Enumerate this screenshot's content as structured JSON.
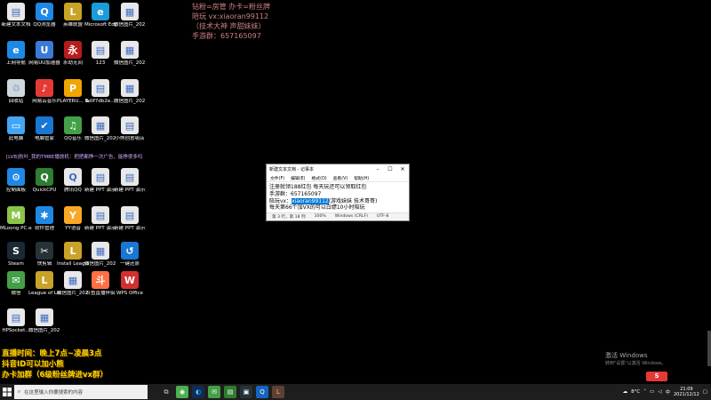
{
  "desktop_icons": [
    {
      "label": "新建文本文档",
      "color": "#e8e8e8",
      "glyph": "▤"
    },
    {
      "label": "QQ浏览器",
      "color": "#1e88e5",
      "glyph": "Q"
    },
    {
      "label": "英雄联盟",
      "color": "#c9a227",
      "glyph": "L"
    },
    {
      "label": "Microsoft Edge",
      "color": "#1b9bd7",
      "glyph": "e"
    },
    {
      "label": "微信图片_2021112...",
      "color": "#e8e8e8",
      "glyph": "▦"
    },
    {
      "label": "上网导航",
      "color": "#1e88e5",
      "glyph": "e"
    },
    {
      "label": "网易UU加速器",
      "color": "#3a7bd5",
      "glyph": "U"
    },
    {
      "label": "永劫无间",
      "color": "#b71c1c",
      "glyph": "永"
    },
    {
      "label": "123",
      "color": "#e8e8e8",
      "glyph": "▤"
    },
    {
      "label": "微信图片_2021112...",
      "color": "#e8e8e8",
      "glyph": "▦"
    },
    {
      "label": "回收站",
      "color": "#cfd8dc",
      "glyph": "♲"
    },
    {
      "label": "网易云音乐",
      "color": "#e53935",
      "glyph": "♪"
    },
    {
      "label": "PLAYERU... BATTLEGR...",
      "color": "#f0a500",
      "glyph": "P"
    },
    {
      "label": "bdlf7db2e...",
      "color": "#e8e8e8",
      "glyph": "▤"
    },
    {
      "label": "微信图片_2021112...",
      "color": "#e8e8e8",
      "glyph": "▦"
    },
    {
      "label": "此电脑",
      "color": "#42a5f5",
      "glyph": "▭"
    },
    {
      "label": "电脑管家",
      "color": "#1976d2",
      "glyph": "✔"
    },
    {
      "label": "QQ音乐",
      "color": "#43a047",
      "glyph": "♫"
    },
    {
      "label": "微信图片_2021112...",
      "color": "#e8e8e8",
      "glyph": "▦"
    },
    {
      "label": "小熊创意吸店",
      "color": "#e8e8e8",
      "glyph": "▤"
    },
    {
      "label": "控制面板",
      "color": "#1e88e5",
      "glyph": "⚙"
    },
    {
      "label": "QuickCPU",
      "color": "#2e7d32",
      "glyph": "Q"
    },
    {
      "label": "腾讯QQ",
      "color": "#e8e8e8",
      "glyph": "Q"
    },
    {
      "label": "新建 PPT 演示文稿",
      "color": "#e8e8e8",
      "glyph": "▤"
    },
    {
      "label": "新建 PPT 演示文稿",
      "color": "#e8e8e8",
      "glyph": "▤"
    },
    {
      "label": "MLoong PC.exe",
      "color": "#8bc34a",
      "glyph": "M"
    },
    {
      "label": "软件管理",
      "color": "#1e88e5",
      "glyph": "✱"
    },
    {
      "label": "YY语音",
      "color": "#f9a825",
      "glyph": "Y"
    },
    {
      "label": "新建 PPT 演示文稿",
      "color": "#e8e8e8",
      "glyph": "▤"
    },
    {
      "label": "新建 PPT 演示文稿",
      "color": "#e8e8e8",
      "glyph": "▤"
    },
    {
      "label": "Steam",
      "color": "#1b2838",
      "glyph": "S"
    },
    {
      "label": "快剪辑",
      "color": "#263238",
      "glyph": "✂"
    },
    {
      "label": "Install League ...",
      "color": "#c9a227",
      "glyph": "L"
    },
    {
      "label": "微信图片_2021112...",
      "color": "#e8e8e8",
      "glyph": "▦"
    },
    {
      "label": "一键还原",
      "color": "#1976d2",
      "glyph": "↺"
    },
    {
      "label": "微信",
      "color": "#43a047",
      "glyph": "✉"
    },
    {
      "label": "League of Legends",
      "color": "#c9a227",
      "glyph": "L"
    },
    {
      "label": "微信图片_2021112...",
      "color": "#e8e8e8",
      "glyph": "▦"
    },
    {
      "label": "斗鱼直播伴侣",
      "color": "#ff7043",
      "glyph": "斗"
    },
    {
      "label": "WPS Office",
      "color": "#d32f2f",
      "glyph": "W"
    },
    {
      "label": "HPSocket...",
      "color": "#e8e8e8",
      "glyph": "▤"
    },
    {
      "label": "微信图片_2021112...",
      "color": "#e8e8e8",
      "glyph": "▦"
    }
  ],
  "overlay_top": {
    "line1": "钻粉=房管 办卡=粉丝牌",
    "line2": "陪玩 vx:xiaoran99112",
    "line3": "（技术大神 声甜妹妹）",
    "line4": "手游群：657165097"
  },
  "overlay_mid": "[LVB]秋叶_我的TMBE播放机：把把都挣一次广告，能挣很多吗",
  "overlay_bottom": {
    "line1": "直播时间：晚上7点~凌晨3点",
    "line2": "抖音ID可以加小熊",
    "line3": "办卡加群（6级粉丝牌进vx群）"
  },
  "notepad": {
    "title": "新建文本文档 - 记事本",
    "menu": [
      "文件(F)",
      "编辑(E)",
      "格式(O)",
      "查看(V)",
      "帮助(H)"
    ],
    "lines": [
      "注册就领188红包 每天玩还可以领取红包",
      "手游群：657165097",
      "每天第66个加VX的可以白嫖10小时陪玩"
    ],
    "line2_prefix": "陪玩vx：",
    "line2_selected": "xiaoran99112",
    "line2_suffix": "(游戏妹妹 技术哥哥)",
    "status": [
      "第 3 行，第 18 列",
      "100%",
      "Windows (CRLF)",
      "UTF-8"
    ]
  },
  "activate": {
    "title": "激活 Windows",
    "subtitle": "转到\"设置\"以激活 Windows。"
  },
  "taskbar": {
    "search_placeholder": "在这里输入你要搜索的内容",
    "temperature": "8°C",
    "lang": "中",
    "time": "21:09",
    "date": "2021/12/12"
  },
  "brand": "S"
}
